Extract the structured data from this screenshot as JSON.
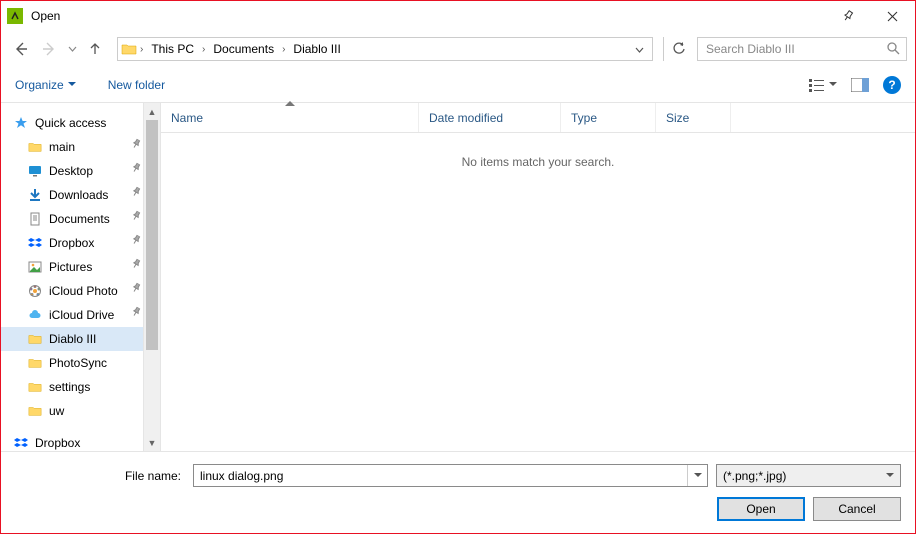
{
  "title": "Open",
  "breadcrumb": [
    "This PC",
    "Documents",
    "Diablo III"
  ],
  "search_placeholder": "Search Diablo III",
  "toolbar": {
    "organize": "Organize",
    "new_folder": "New folder"
  },
  "columns": {
    "name": "Name",
    "date": "Date modified",
    "type": "Type",
    "size": "Size"
  },
  "empty_message": "No items match your search.",
  "tree": {
    "quick_access": "Quick access",
    "items": [
      {
        "label": "main",
        "icon": "folder",
        "pinned": true
      },
      {
        "label": "Desktop",
        "icon": "desktop",
        "pinned": true
      },
      {
        "label": "Downloads",
        "icon": "downloads",
        "pinned": true
      },
      {
        "label": "Documents",
        "icon": "documents",
        "pinned": true
      },
      {
        "label": "Dropbox",
        "icon": "dropbox",
        "pinned": true
      },
      {
        "label": "Pictures",
        "icon": "pictures",
        "pinned": true
      },
      {
        "label": "iCloud Photo",
        "icon": "icloud-photo",
        "pinned": true
      },
      {
        "label": "iCloud Drive",
        "icon": "icloud",
        "pinned": true
      },
      {
        "label": "Diablo III",
        "icon": "folder",
        "pinned": false,
        "selected": true
      },
      {
        "label": "PhotoSync",
        "icon": "folder",
        "pinned": false
      },
      {
        "label": "settings",
        "icon": "folder",
        "pinned": false
      },
      {
        "label": "uw",
        "icon": "folder",
        "pinned": false
      }
    ],
    "dropbox": "Dropbox"
  },
  "file_name_label": "File name:",
  "file_name_value": "linux dialog.png",
  "filter": "(*.png;*.jpg)",
  "buttons": {
    "open": "Open",
    "cancel": "Cancel"
  }
}
